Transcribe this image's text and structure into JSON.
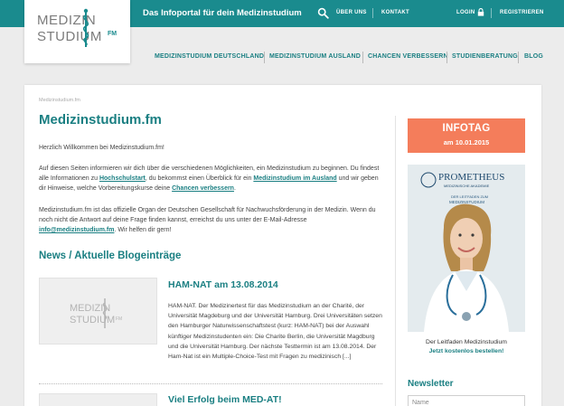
{
  "header": {
    "tagline": "Das Infoportal für dein Medizinstudium",
    "nav": {
      "about": "ÜBER UNS",
      "contact": "KONTAKT",
      "login": "LOGIN",
      "register": "REGISTRIEREN"
    },
    "logo": {
      "line1": "MEDIZIN",
      "line2": "STUDIUM",
      "suffix": "FM"
    }
  },
  "main_nav": [
    "MEDIZINSTUDIUM DEUTSCHLAND",
    "MEDIZINSTUDIUM AUSLAND",
    "CHANCEN VERBESSERN",
    "STUDIENBERATUNG",
    "BLOG"
  ],
  "breadcrumb": "Medizinstudium.fm",
  "page_title": "Medizinstudium.fm",
  "intro": {
    "welcome": "Herzlich Willkommen bei Medizinstudium.fm!",
    "p2_a": "Auf diesen Seiten informieren wir dich über die verschiedenen Möglichkeiten, ein Medizinstudium zu beginnen. Du findest alle Informationen zu ",
    "p2_link1": "Hochschulstart",
    "p2_b": ", du bekommst einen Überblick für ein ",
    "p2_link2": "Medizinstudium im Ausland",
    "p2_c": " und wir geben dir Hinweise, welche Vorbereitungskurse deine ",
    "p2_link3": "Chancen verbessern",
    "p2_d": ".",
    "p3_a": "Medizinstudium.fm ist das offizielle Organ der Deutschen Gesellschaft für Nachwuchsförderung in der Medizin. Wenn du noch nicht die Antwort auf deine Frage finden kannst, erreichst du uns unter der E-Mail-Adresse ",
    "p3_link": "info@medizinstudium.fm",
    "p3_b": ". Wir helfen dir gern!"
  },
  "news": {
    "title": "News / Aktuelle Blogeinträge",
    "posts": [
      {
        "title": "HAM-NAT am 13.08.2014",
        "excerpt": "HAM-NAT. Der Medizinertest für das Medizinstudium an der Charité, der Universität Magdeburg und der Universität Hamburg. Drei Universitäten setzen den Hamburger Naturwissenschaftstest (kurz: HAM-NAT) bei der Auswahl künftiger Medizinstudenten ein: Die Charite Berlin, die Universität Magdburg und die Universität Hamburg. Der nächste Testtermin ist am 13.08.2014. Der Ham-Nat ist ein Multiple-Choice-Test mit Fragen zu medizinisch [...]"
      },
      {
        "title": "Viel Erfolg beim MED-AT!"
      }
    ]
  },
  "sidebar": {
    "infotag": {
      "title": "INFOTAG",
      "date": "am 10.01.2015"
    },
    "promo": {
      "brand": "PROMETHEUS",
      "brand_sub": "MEDIZINISCHE AKADEMIE",
      "guide_line1": "DER LEITFADEN ZUM",
      "guide_line2": "MEDIZINSTUDIUM"
    },
    "caption": "Der Leitfaden Medizinstudium",
    "caption_link": "Jetzt kostenlos bestellen!",
    "newsletter": {
      "title": "Newsletter",
      "placeholder": "Name"
    }
  },
  "colors": {
    "brand": "#1a8b8e",
    "accent": "#f47d5b"
  }
}
